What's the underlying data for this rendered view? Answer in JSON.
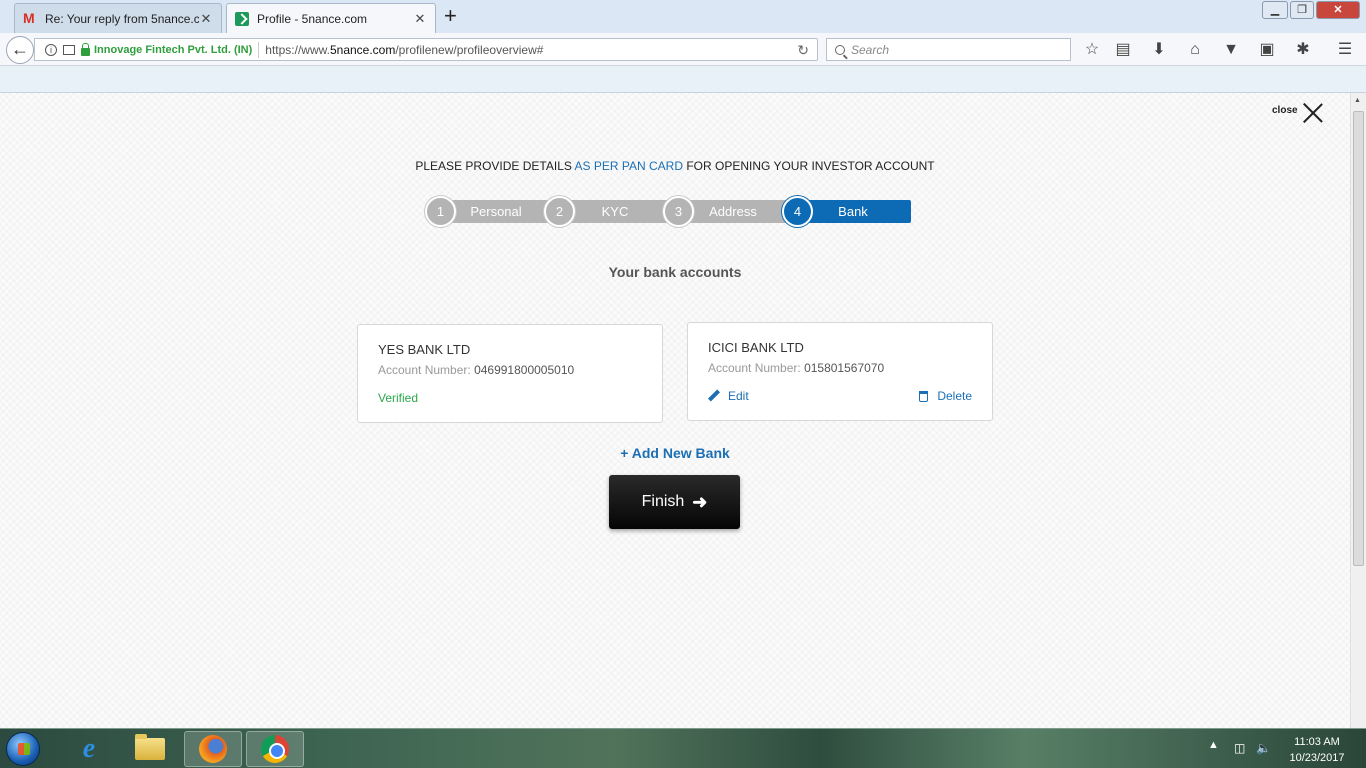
{
  "browser": {
    "tabs": [
      {
        "title": "Re: Your reply from 5nance.c",
        "icon": "gmail-icon",
        "close": "✕"
      },
      {
        "title": "Profile - 5nance.com",
        "icon": "site-favicon",
        "close": "✕"
      }
    ],
    "new_tab": "+",
    "org_name": "Innovage Fintech Pvt. Ltd. (IN)",
    "url_prefix": "https://www.",
    "url_domain": "5nance.com",
    "url_path": "/profilenew/profileoverview#",
    "search_placeholder": "Search",
    "window_controls": {
      "minimize": "▁",
      "maximize": "❐",
      "close": "✕"
    }
  },
  "page": {
    "close_label": "close",
    "instruction": {
      "before": "PLEASE PROVIDE DETAILS ",
      "highlight": "AS PER PAN CARD",
      "after": " FOR OPENING YOUR INVESTOR ACCOUNT"
    },
    "steps": [
      {
        "number": "1",
        "label": "Personal",
        "active": false
      },
      {
        "number": "2",
        "label": "KYC",
        "active": false
      },
      {
        "number": "3",
        "label": "Address",
        "active": false
      },
      {
        "number": "4",
        "label": "Bank",
        "active": true
      }
    ],
    "section_title": "Your bank accounts",
    "accounts": [
      {
        "bank_name": "YES BANK LTD",
        "account_label": "Account Number:",
        "account_number": "046991800005010",
        "status": "Verified"
      },
      {
        "bank_name": "ICICI BANK LTD",
        "account_label": "Account Number:",
        "account_number": "015801567070",
        "edit_label": "Edit",
        "delete_label": "Delete"
      }
    ],
    "add_bank_label": "+ Add New Bank",
    "finish_label": "Finish",
    "colors": {
      "accent": "#1c6fb3",
      "step_active": "#0d6bb5",
      "step_inactive": "#b4b4b4",
      "verified": "#2aa84a"
    }
  },
  "taskbar": {
    "time": "11:03 AM",
    "date": "10/23/2017",
    "tray_expand": "▲"
  }
}
